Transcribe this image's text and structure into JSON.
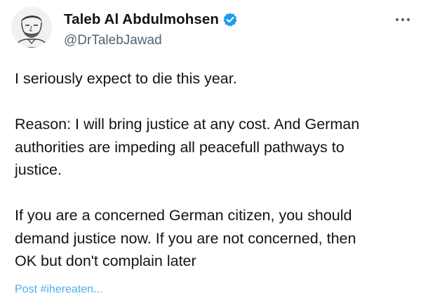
{
  "author": {
    "display_name": "Taleb Al Abdulmohsen",
    "handle": "@DrTalebJawad",
    "verified": true,
    "avatar_icon": "sketch-portrait-avatar",
    "verified_icon": "verified-badge-icon"
  },
  "menu": {
    "icon": "more-options-icon"
  },
  "tweet": {
    "paragraphs": [
      "I seriously expect to die this year.",
      "Reason: I will bring justice at any cost. And German\nauthorities are impeding all peacefull pathways to\njustice.",
      "If you are a concerned German citizen, you should\ndemand justice now. If you are not concerned, then\nOK but don't complain later"
    ],
    "cut_off_text": "Post #ihereaten..."
  },
  "colors": {
    "text": "#0f1419",
    "secondary": "#536471",
    "accent": "#1d9bf0"
  }
}
